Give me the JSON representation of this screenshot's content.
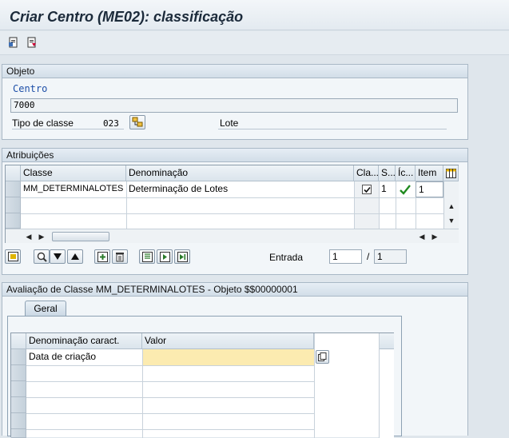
{
  "window": {
    "title": "Criar Centro (ME02): classificação"
  },
  "toolbar": {
    "icons": [
      "document-icon",
      "save-document-icon"
    ]
  },
  "objeto": {
    "header": "Objeto",
    "centro_label": "Centro",
    "centro_value": "7000",
    "tipo_label": "Tipo de classe",
    "tipo_value": "023",
    "tipo_desc": "Lote"
  },
  "atribuicoes": {
    "header": "Atribuições",
    "columns": [
      "Classe",
      "Denominação",
      "Cla...",
      "S...",
      "Íc...",
      "Item"
    ],
    "rows": [
      {
        "classe": "MM_DETERMINALOTES",
        "denominacao": "Determinação de Lotes",
        "cla_checked": true,
        "s": "1",
        "icon": "check-icon",
        "item": "1"
      }
    ],
    "entrada_label": "Entrada",
    "entrada_value": "1",
    "entrada_sep": "/",
    "entrada_total": "1"
  },
  "avaliacao": {
    "header": "Avaliação de Classe MM_DETERMINALOTES - Objeto $$00000001",
    "tab_label": "Geral",
    "columns": [
      "Denominação caract.",
      "Valor"
    ],
    "rows": [
      {
        "denominacao": "Data de criação",
        "valor": ""
      }
    ]
  },
  "colors": {
    "accent_yellow": "#fcebb0",
    "label_blue": "#1d4fa8",
    "check_green": "#1f8a1f"
  }
}
